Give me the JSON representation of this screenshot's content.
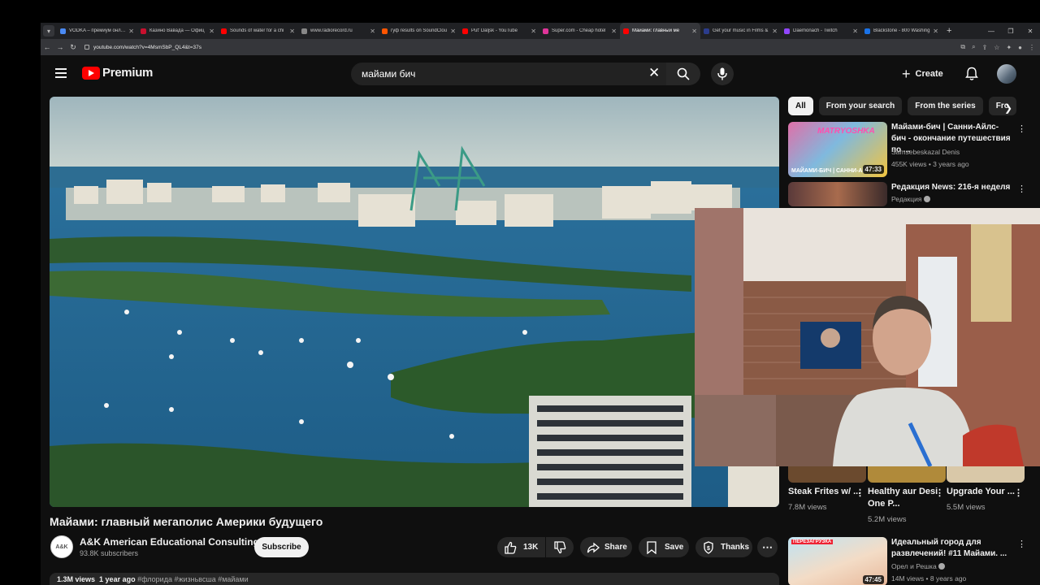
{
  "browser": {
    "tabs": [
      {
        "title": "VODKA – премиум онлайн",
        "color": "#4a8af4"
      },
      {
        "title": "Казино Вавада — Офиц",
        "color": "#c8102e"
      },
      {
        "title": "Sounds of water for a chi",
        "color": "#f00"
      },
      {
        "title": "www.radiorecord.ru",
        "color": "#888"
      },
      {
        "title": "гуф results on SoundClou",
        "color": "#f50"
      },
      {
        "title": "Put' Daljsk - YouTube",
        "color": "#f00"
      },
      {
        "title": "Super.com - Cheap hotel",
        "color": "#e0359a"
      },
      {
        "title": "Майами: главный ме",
        "color": "#f00",
        "active": true
      },
      {
        "title": "Get your music in Films &",
        "color": "#2b3c8c"
      },
      {
        "title": "Daemonach - Twitch",
        "color": "#9146ff"
      },
      {
        "title": "Blackstone - 800 Washing",
        "color": "#1a73e8"
      }
    ],
    "url": "youtube.com/watch?v=4MsmSbP_QL4&t=37s"
  },
  "yt": {
    "brand": "Premium",
    "search_value": "майами бич",
    "create_label": "Create"
  },
  "video": {
    "title": "Майами: главный мегаполис Америки будущего",
    "channel": "A&K American Educational Consulting",
    "subscribers": "93.8K subscribers",
    "subscribe_label": "Subscribe",
    "likes": "13K",
    "share_label": "Share",
    "save_label": "Save",
    "thanks_label": "Thanks",
    "views": "1.3M views",
    "age": "1 year ago",
    "tags": "#флорида #жизньвсша #майами"
  },
  "chips": [
    "All",
    "From your search",
    "From the series",
    "Fro"
  ],
  "recs": [
    {
      "title": "Майами-бич | Санни-Айлс-бич - окончание путешествия по ...",
      "channel": "Samsebeskazal Denis",
      "meta": "455K views • 3 years ago",
      "duration": "47:33",
      "thumb_text": "MATRYOSHKA",
      "thumb_sub": "МАЙАМИ-БИЧ | САННИ-АЙ"
    },
    {
      "title": "Редакция News: 216-я неделя",
      "channel": "Редакция"
    },
    {
      "title": "Идеальный город для развлечений! #11 Майами. ...",
      "channel": "Орел и Решка",
      "meta": "14M views • 8 years ago",
      "duration": "47:45",
      "thumb_text": "ПЕРЕЗАГРУЗКА"
    }
  ],
  "grid": [
    {
      "title": "Steak Frites w/ ...",
      "views": "7.8M views"
    },
    {
      "title": "Healthy aur Desi One P...",
      "views": "5.2M views"
    },
    {
      "title": "Upgrade Your ...",
      "views": "5.5M views"
    }
  ],
  "colors": {
    "accent": "#ff0000",
    "bg": "#0f0f0f",
    "surface": "#272727"
  }
}
